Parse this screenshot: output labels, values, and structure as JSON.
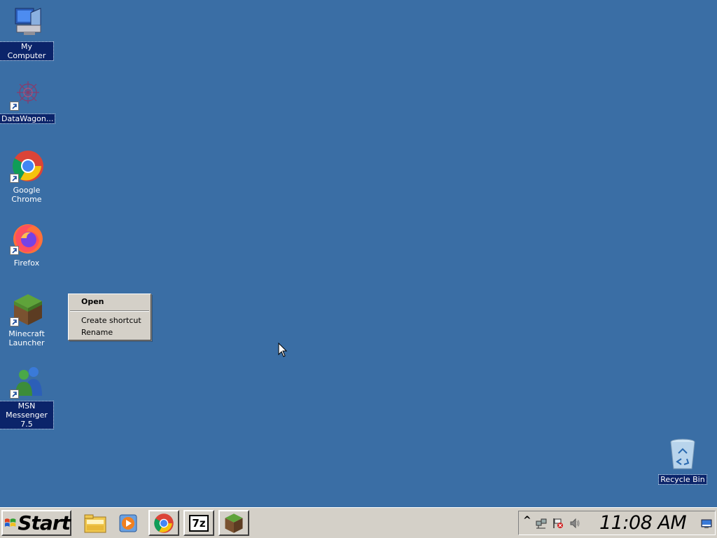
{
  "desktop": {
    "icons": [
      {
        "label": "My Computer",
        "selected": true
      },
      {
        "label": "DataWagon...",
        "selected": true
      },
      {
        "label": "Google Chrome",
        "selected": false
      },
      {
        "label": "Firefox",
        "selected": false
      },
      {
        "label": "Minecraft Launcher",
        "selected": false
      },
      {
        "label": "MSN Messenger 7.5",
        "selected": true
      },
      {
        "label": "Recycle Bin",
        "selected": true
      }
    ]
  },
  "context_menu": {
    "items": [
      {
        "label": "Open",
        "default": true
      },
      {
        "label": "Create shortcut",
        "default": false
      },
      {
        "label": "Rename",
        "default": false
      }
    ]
  },
  "taskbar": {
    "start_label": "Start",
    "quick_launch": [
      "file-explorer-icon",
      "media-player-icon",
      "chrome-icon",
      "7zip-icon",
      "minecraft-icon"
    ],
    "sevenzip_label": "7z",
    "tray": {
      "expand": "^",
      "clock": "11:08 AM"
    }
  },
  "colors": {
    "desktop": "#3a6ea5",
    "taskbar": "#d4d0c8",
    "selection": "#0b246a"
  }
}
